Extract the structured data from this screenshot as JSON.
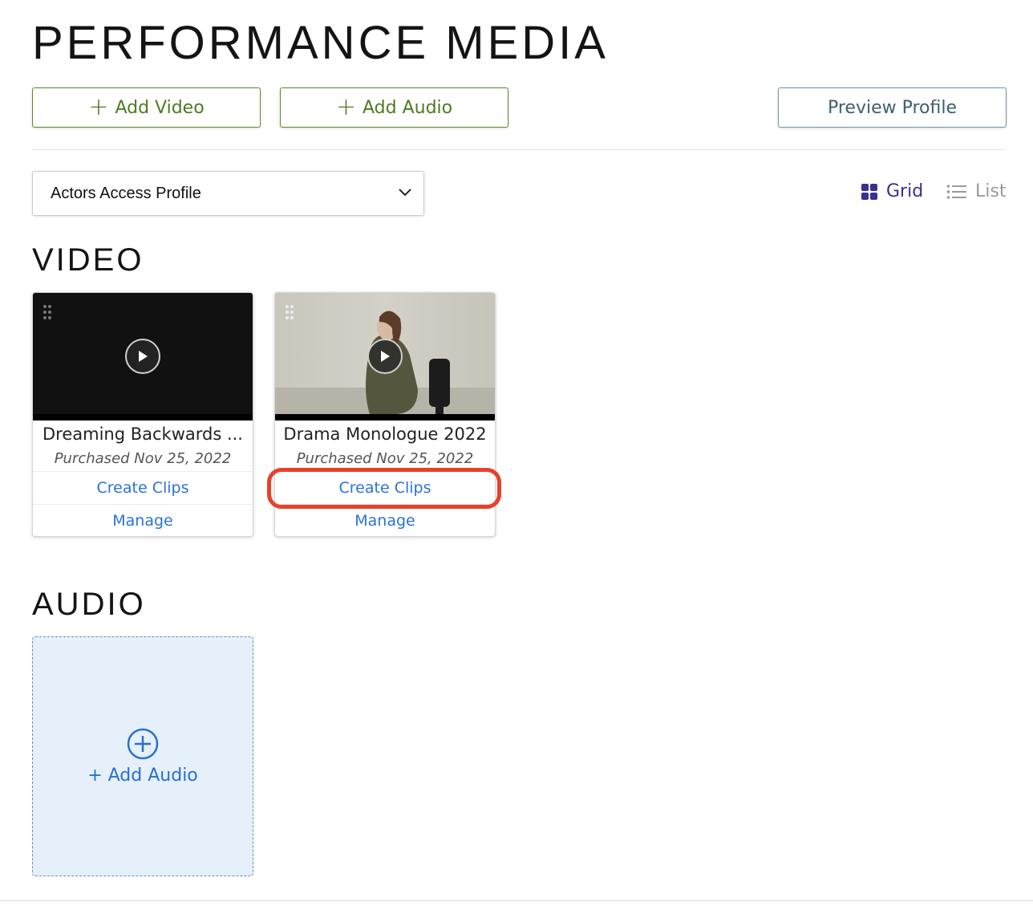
{
  "page": {
    "title": "PERFORMANCE MEDIA"
  },
  "toolbar": {
    "add_video_label": "Add Video",
    "add_audio_label": "Add Audio",
    "preview_label": "Preview Profile"
  },
  "profile_select": {
    "value": "Actors Access Profile"
  },
  "view_toggle": {
    "grid_label": "Grid",
    "list_label": "List",
    "active": "Grid"
  },
  "video": {
    "heading": "VIDEO",
    "cards": [
      {
        "title": "Dreaming Backwards ...",
        "date": "Purchased Nov 25, 2022",
        "create_clips": "Create Clips",
        "manage": "Manage",
        "thumbnail": "black"
      },
      {
        "title": "Drama Monologue 2022",
        "date": "Purchased Nov 25, 2022",
        "create_clips": "Create Clips",
        "manage": "Manage",
        "thumbnail": "woman-seated-on-chair"
      }
    ]
  },
  "audio": {
    "heading": "AUDIO",
    "add_label": "+ Add Audio"
  },
  "icons": [
    "plus-icon",
    "chevron-down-icon",
    "grid-icon",
    "list-icon",
    "drag-handle-icon",
    "play-icon",
    "plus-circle-icon"
  ],
  "colors": {
    "accent_green": "#4e7a22",
    "link_blue": "#2a73d6",
    "grid_active": "#3b2f8f",
    "highlight": "#e8402b",
    "audio_bg": "#e6f0fb"
  }
}
